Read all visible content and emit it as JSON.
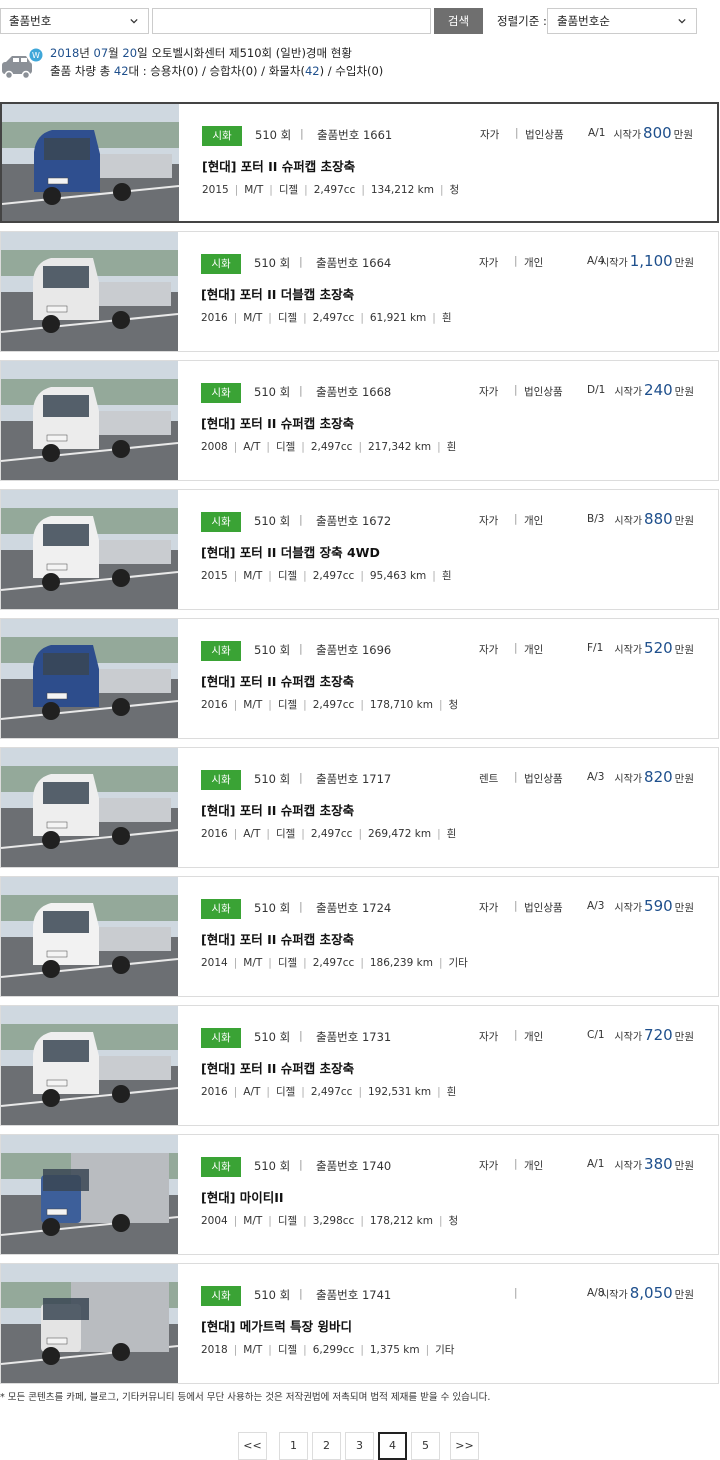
{
  "search": {
    "field_select": "출품번호",
    "input_value": "",
    "button": "검색",
    "sort_label": "정렬기준 :",
    "sort_value": "출품번호순"
  },
  "summary": {
    "line1_year": "2018",
    "line1_month": "07",
    "line1_day": "20",
    "line1_rest": "오토벨시화센터 제510회 (일반)경매 현황",
    "line2_prefix": "출품 차량 총",
    "total": "42",
    "line2_mid": "대 : 승용차(0) / 승합차(0) / 화물차(",
    "truck_count": "42",
    "line2_end": ") / 수입차(0)"
  },
  "listing": [
    {
      "badge": "시화",
      "round": "510 회",
      "lot_label": "출품번호",
      "lot": "1661",
      "owner": "자가",
      "seller": "법인상품",
      "grade": "A/1",
      "price_label": "시작가",
      "price": "800",
      "unit": "만원",
      "title": "[현대] 포터 II 슈퍼캡 초장축",
      "year": "2015",
      "trans": "M/T",
      "fuel": "디젤",
      "cc": "2,497cc",
      "km": "134,212 km",
      "color": "청",
      "paint": "#2f4f8f"
    },
    {
      "badge": "시화",
      "round": "510 회",
      "lot_label": "출품번호",
      "lot": "1664",
      "owner": "자가",
      "seller": "개인",
      "grade": "A/4",
      "price_label": "시작가",
      "price": "1,100",
      "unit": "만원",
      "title": "[현대] 포터 II 더블캡 초장축",
      "year": "2016",
      "trans": "M/T",
      "fuel": "디젤",
      "cc": "2,497cc",
      "km": "61,921 km",
      "color": "흰",
      "paint": "#e8e8e8"
    },
    {
      "badge": "시화",
      "round": "510 회",
      "lot_label": "출품번호",
      "lot": "1668",
      "owner": "자가",
      "seller": "법인상품",
      "grade": "D/1",
      "price_label": "시작가",
      "price": "240",
      "unit": "만원",
      "title": "[현대] 포터 II 슈퍼캡 초장축",
      "year": "2008",
      "trans": "A/T",
      "fuel": "디젤",
      "cc": "2,497cc",
      "km": "217,342 km",
      "color": "흰",
      "paint": "#ececec"
    },
    {
      "badge": "시화",
      "round": "510 회",
      "lot_label": "출품번호",
      "lot": "1672",
      "owner": "자가",
      "seller": "개인",
      "grade": "B/3",
      "price_label": "시작가",
      "price": "880",
      "unit": "만원",
      "title": "[현대] 포터 II 더블캡 장축 4WD",
      "year": "2015",
      "trans": "M/T",
      "fuel": "디젤",
      "cc": "2,497cc",
      "km": "95,463 km",
      "color": "흰",
      "paint": "#f0f0f0"
    },
    {
      "badge": "시화",
      "round": "510 회",
      "lot_label": "출품번호",
      "lot": "1696",
      "owner": "자가",
      "seller": "개인",
      "grade": "F/1",
      "price_label": "시작가",
      "price": "520",
      "unit": "만원",
      "title": "[현대] 포터 II 슈퍼캡 초장축",
      "year": "2016",
      "trans": "M/T",
      "fuel": "디젤",
      "cc": "2,497cc",
      "km": "178,710 km",
      "color": "청",
      "paint": "#2d4d8c"
    },
    {
      "badge": "시화",
      "round": "510 회",
      "lot_label": "출품번호",
      "lot": "1717",
      "owner": "렌트",
      "seller": "법인상품",
      "grade": "A/3",
      "price_label": "시작가",
      "price": "820",
      "unit": "만원",
      "title": "[현대] 포터 II 슈퍼캡 초장축",
      "year": "2016",
      "trans": "A/T",
      "fuel": "디젤",
      "cc": "2,497cc",
      "km": "269,472 km",
      "color": "흰",
      "paint": "#eeeeee"
    },
    {
      "badge": "시화",
      "round": "510 회",
      "lot_label": "출품번호",
      "lot": "1724",
      "owner": "자가",
      "seller": "법인상품",
      "grade": "A/3",
      "price_label": "시작가",
      "price": "590",
      "unit": "만원",
      "title": "[현대] 포터 II 슈퍼캡 초장축",
      "year": "2014",
      "trans": "M/T",
      "fuel": "디젤",
      "cc": "2,497cc",
      "km": "186,239 km",
      "color": "기타",
      "paint": "#f2f2f2"
    },
    {
      "badge": "시화",
      "round": "510 회",
      "lot_label": "출품번호",
      "lot": "1731",
      "owner": "자가",
      "seller": "개인",
      "grade": "C/1",
      "price_label": "시작가",
      "price": "720",
      "unit": "만원",
      "title": "[현대] 포터 II 슈퍼캡 초장축",
      "year": "2016",
      "trans": "A/T",
      "fuel": "디젤",
      "cc": "2,497cc",
      "km": "192,531 km",
      "color": "흰",
      "paint": "#efefef"
    },
    {
      "badge": "시화",
      "round": "510 회",
      "lot_label": "출품번호",
      "lot": "1740",
      "owner": "자가",
      "seller": "개인",
      "grade": "A/1",
      "price_label": "시작가",
      "price": "380",
      "unit": "만원",
      "title": "[현대] 마이티II",
      "year": "2004",
      "trans": "M/T",
      "fuel": "디젤",
      "cc": "3,298cc",
      "km": "178,212 km",
      "color": "청",
      "paint": "#3d5f9a"
    },
    {
      "badge": "시화",
      "round": "510 회",
      "lot_label": "출품번호",
      "lot": "1741",
      "owner": "",
      "seller": "",
      "grade": "A/8",
      "price_label": "시작가",
      "price": "8,050",
      "unit": "만원",
      "title": "[현대] 메가트럭 특장 윙바디",
      "year": "2018",
      "trans": "M/T",
      "fuel": "디젤",
      "cc": "6,299cc",
      "km": "1,375 km",
      "color": "기타",
      "paint": "#e4e4e4"
    }
  ],
  "notice": "* 모든 콘텐츠를 카페, 블로그, 기타커뮤니티 등에서 무단 사용하는 것은 저작권법에 저촉되며 법적 제재를 받을 수 있습니다.",
  "pagination": {
    "prev": "<<",
    "pages": [
      "1",
      "2",
      "3",
      "4",
      "5"
    ],
    "current": "4",
    "next": ">>"
  },
  "colors": {
    "badge_green": "#3aa335",
    "price_blue": "#1e4f8c",
    "search_button": "#6f6f6f"
  }
}
